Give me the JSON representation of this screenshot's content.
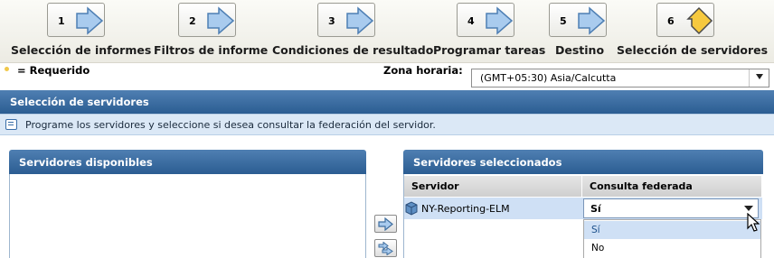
{
  "wizard": {
    "steps": [
      {
        "number": "1",
        "label": "Selección de informes",
        "state": "pending",
        "icon": "arrow-right-icon"
      },
      {
        "number": "2",
        "label": "Filtros de informe",
        "state": "pending",
        "icon": "arrow-right-icon"
      },
      {
        "number": "3",
        "label": "Condiciones de resultado",
        "state": "pending",
        "icon": "arrow-right-icon"
      },
      {
        "number": "4",
        "label": "Programar tareas",
        "state": "pending",
        "icon": "arrow-right-icon"
      },
      {
        "number": "5",
        "label": "Destino",
        "state": "pending",
        "icon": "arrow-right-icon"
      },
      {
        "number": "6",
        "label": "Selección de servidores",
        "state": "current",
        "icon": "diamond-arrow-icon"
      }
    ],
    "colors": {
      "arrow": "#a9cbee",
      "arrow_stroke": "#4e7fb4",
      "current": "#f6c93f"
    }
  },
  "required_note": "= Requerido",
  "timezone": {
    "label": "Zona horaria:",
    "value": "(GMT+05:30) Asia/Calcutta"
  },
  "section": {
    "title": "Selección de servidores",
    "info": "Programe los servidores y seleccione si desea consultar la federación del servidor."
  },
  "available": {
    "title": "Servidores disponibles",
    "items": []
  },
  "selected": {
    "title": "Servidores seleccionados",
    "columns": [
      "Servidor",
      "Consulta federada"
    ],
    "rows": [
      {
        "server": "NY-Reporting-ELM",
        "federated": "Sí"
      }
    ],
    "dropdown_options": [
      "Sí",
      "No"
    ]
  },
  "colors": {
    "header_blue": "#2b5d92",
    "info_bg": "#dbe8f6",
    "row_selected": "#cfe0f5",
    "required_dot": "#f1c84b"
  }
}
